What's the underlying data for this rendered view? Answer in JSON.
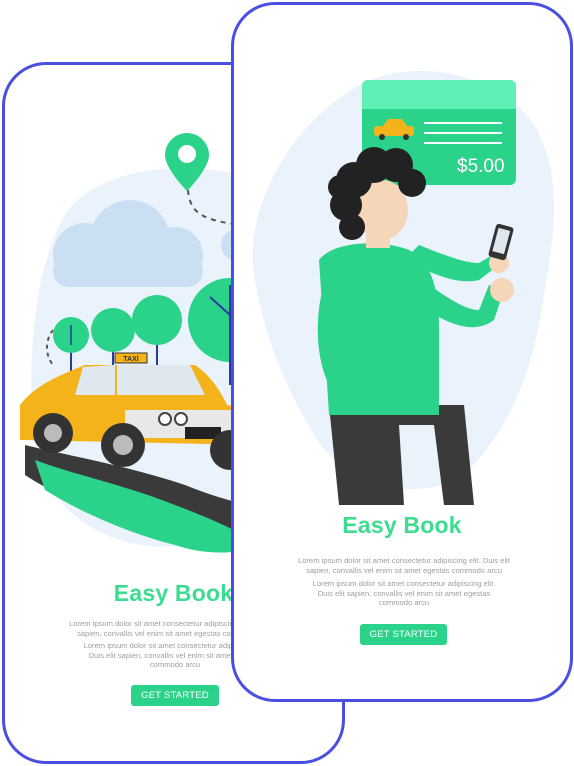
{
  "screens": [
    {
      "title": "Easy Book",
      "para1": [
        "Lorem ipsum dolor sit amet consectetur adipiscing elit. Duis elit",
        "sapien, convallis vel enim sit amet egestas commodo arcu"
      ],
      "para2": [
        "Lorem ipsum dolor sit amet consectetur adipiscing elit.",
        "Duis elit sapien, convallis vel enim sit amet egestas",
        "commodo arcu"
      ],
      "button": "GET STARTED",
      "taxi_sign": "TAXI"
    },
    {
      "title": "Easy Book",
      "para1": [
        "Lorem ipsum dolor sit amet consectetur adipiscing elit. Duis elit",
        "sapien, convallis vel enim sit amet egestas commodo arcu"
      ],
      "para2": [
        "Lorem ipsum dolor sit amet consectetur adipiscing elit.",
        "Duis elit sapien, convallis vel enim sit amet egestas",
        "commodo arcu"
      ],
      "button": "GET STARTED",
      "price": "$5.00"
    }
  ],
  "colors": {
    "frame": "#4b4fe0",
    "accent_green": "#2bd38a",
    "taxi_yellow": "#f5b31b"
  }
}
